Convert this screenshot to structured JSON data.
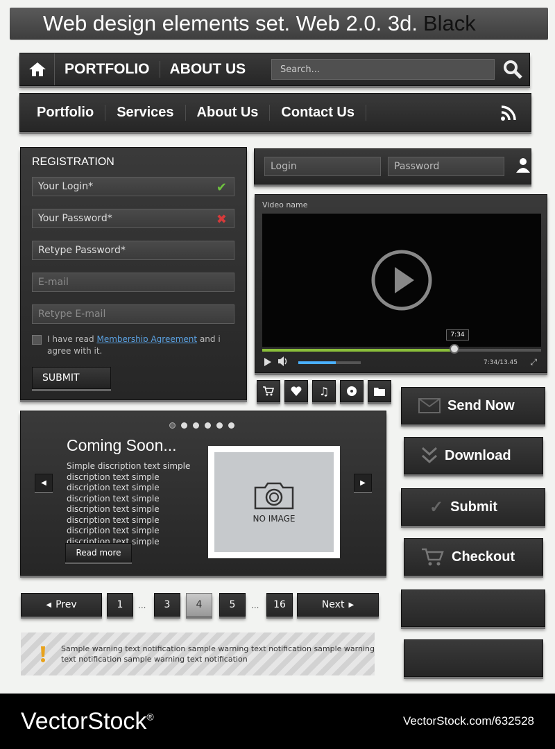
{
  "title": {
    "main": "Web design elements set. Web 2.0. 3d.",
    "highlight": "Black"
  },
  "nav_top": {
    "items": [
      "PORTFOLIO",
      "ABOUT US"
    ],
    "search_placeholder": "Search..."
  },
  "nav_main": {
    "items": [
      "Portfolio",
      "Services",
      "About Us",
      "Contact Us"
    ]
  },
  "registration": {
    "heading": "REGISTRATION",
    "fields": [
      "Your Login*",
      "Your Password*",
      "Retype Password*",
      "E-mail",
      "Retype E-mail"
    ],
    "agree_prefix": "I have read",
    "agree_link": "Membership Agreement",
    "agree_suffix": "and i agree with it.",
    "submit": "SUBMIT"
  },
  "login": {
    "login_placeholder": "Login",
    "password_placeholder": "Password"
  },
  "video": {
    "name": "Video name",
    "tooltip": "7:34",
    "time": "7:34/13.45",
    "progress": 0.69,
    "volume": 0.6
  },
  "icons": [
    "cart-icon",
    "heart-icon",
    "music-icon",
    "disc-icon",
    "folder-icon"
  ],
  "slider": {
    "heading": "Coming Soon...",
    "description": "Simple discription text simple discription text simple discription text simple discription text simple discription text simple discription text simple discription text simple discription text simple discription ...",
    "read_more": "Read more",
    "no_image": "NO IMAGE"
  },
  "actions": [
    "Send Now",
    "Download",
    "Submit",
    "Checkout"
  ],
  "pagination": {
    "prev": "Prev",
    "next": "Next",
    "pages": [
      "1",
      "3",
      "4",
      "5",
      "16"
    ],
    "ellipsis": "...",
    "current": "4"
  },
  "warning": "Sample warning text notification sample warning text notification sample warning text notification sample warning text notification",
  "footer": {
    "brand": "VectorStock",
    "brand_mark": "®",
    "id": "VectorStock.com/632528"
  }
}
